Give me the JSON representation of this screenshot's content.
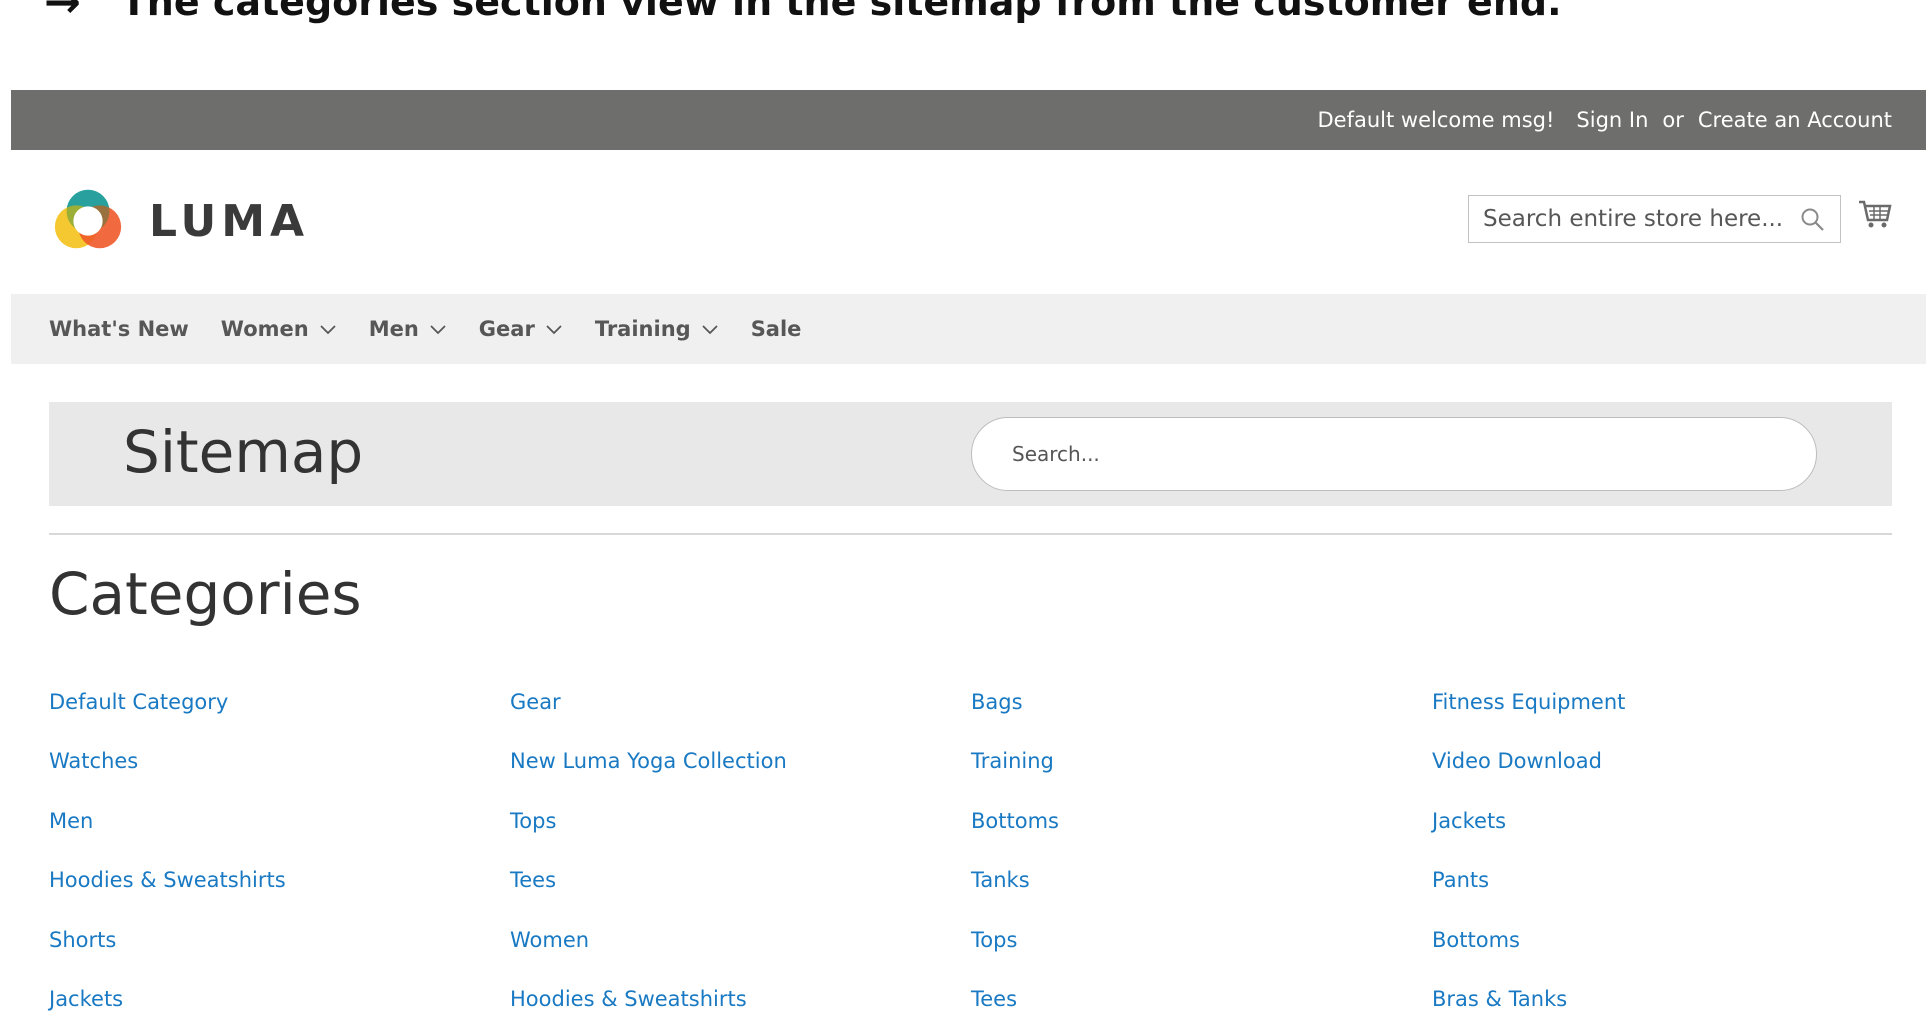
{
  "caption": {
    "arrow": "→",
    "text": "The categories section view in the sitemap from the customer end."
  },
  "topbar": {
    "welcome": "Default welcome msg!",
    "sign_in": "Sign In",
    "or": "or",
    "create_account": "Create an Account"
  },
  "header": {
    "logo_text": "LUMA",
    "search_placeholder": "Search entire store here..."
  },
  "nav": {
    "items": [
      {
        "label": "What's New",
        "dropdown": false
      },
      {
        "label": "Women",
        "dropdown": true
      },
      {
        "label": "Men",
        "dropdown": true
      },
      {
        "label": "Gear",
        "dropdown": true
      },
      {
        "label": "Training",
        "dropdown": true
      },
      {
        "label": "Sale",
        "dropdown": false
      }
    ]
  },
  "sitemap": {
    "title": "Sitemap",
    "search_placeholder": "Search..."
  },
  "categories": {
    "title": "Categories",
    "links": [
      "Default Category",
      "Gear",
      "Bags",
      "Fitness Equipment",
      "Watches",
      "New Luma Yoga Collection",
      "Training",
      "Video Download",
      "Men",
      "Tops",
      "Bottoms",
      "Jackets",
      "Hoodies & Sweatshirts",
      "Tees",
      "Tanks",
      "Pants",
      "Shorts",
      "Women",
      "Tops",
      "Bottoms",
      "Jackets",
      "Hoodies & Sweatshirts",
      "Tees",
      "Bras & Tanks"
    ]
  },
  "colors": {
    "topbar_bg": "#6e6e6c",
    "nav_bg": "#f0f0f0",
    "link": "#1979c3",
    "banner_bg": "#e8e8e8"
  }
}
